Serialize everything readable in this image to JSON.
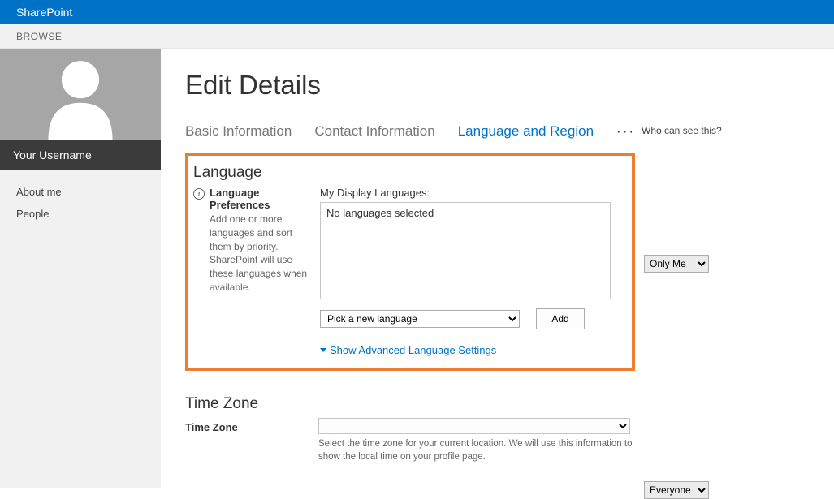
{
  "header": {
    "app_title": "SharePoint",
    "browse_tab": "BROWSE"
  },
  "sidebar": {
    "username": "Your Username",
    "nav": [
      {
        "label": "About me"
      },
      {
        "label": "People"
      }
    ]
  },
  "page": {
    "title": "Edit Details",
    "tabs": [
      {
        "label": "Basic Information"
      },
      {
        "label": "Contact Information"
      },
      {
        "label": "Language and Region"
      }
    ],
    "who_can_see": "Who can see this?"
  },
  "language_section": {
    "header": "Language",
    "pref_title": "Language Preferences",
    "pref_desc": "Add one or more languages and sort them by priority. SharePoint will use these languages when available.",
    "display_label": "My Display Languages:",
    "display_value": "No languages selected",
    "pick_option": "Pick a new language",
    "add_label": "Add",
    "advanced_link": "Show Advanced Language Settings",
    "privacy_options": [
      "Only Me"
    ],
    "privacy_value": "Only Me"
  },
  "timezone_section": {
    "header": "Time Zone",
    "label": "Time Zone",
    "hint": "Select the time zone for your current location. We will use this information to show the local time on your profile page.",
    "privacy_options": [
      "Everyone"
    ],
    "privacy_value": "Everyone"
  }
}
